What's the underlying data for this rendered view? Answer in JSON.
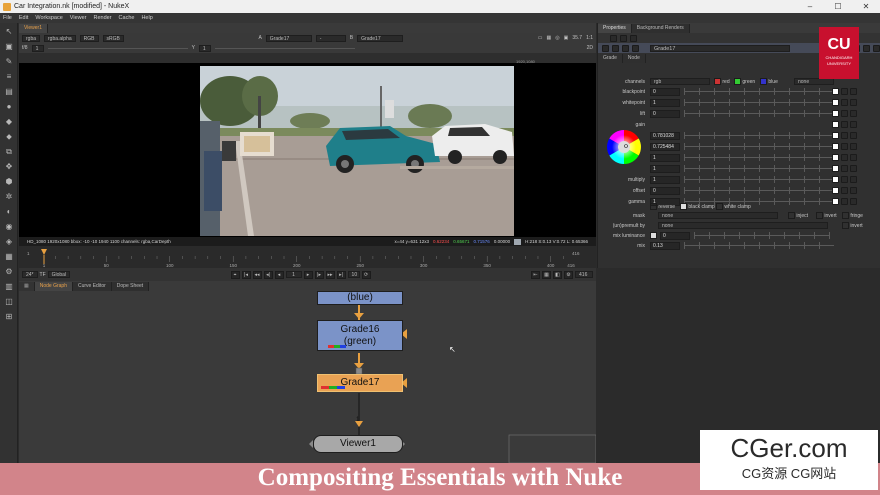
{
  "window": {
    "title": "Car Integration.nk [modified] - NukeX"
  },
  "menu": [
    "File",
    "Edit",
    "Workspace",
    "Viewer",
    "Render",
    "Cache",
    "Help"
  ],
  "viewer": {
    "tab": "Viewer1",
    "channel_set": "rgba",
    "channel": "rgba.alpha",
    "colorspace": "RGB",
    "lut": "sRGB",
    "frame_field": "1",
    "gain_field": "f/8",
    "exposure_field": "1",
    "input_a_label": "A",
    "input_a": "Grade17",
    "input_b_label": "B",
    "input_b": "Grade17",
    "compare_dash": "-",
    "zoom": "35.7",
    "proxy": "1:1",
    "view_mode": "2D",
    "corner_label": "1920,1080",
    "info_left": "HD_1080 1920x1080  bbox: -10 -10 1940 1100 channels: rgba,CarDepth",
    "info_mid": "x=44 y=631 12x3",
    "info_r": "0.62234",
    "info_g": "0.65671",
    "info_b": "0.71576",
    "info_a": "0.00000",
    "info_hsv": "H:218 S:0.13 V:0.72 L: 0.65366",
    "timeline_ticks": [
      "1",
      "50",
      "100",
      "150",
      "200",
      "250",
      "300",
      "350",
      "400",
      "416"
    ],
    "frame_start": "1",
    "frame_end": "416",
    "fps": "24*",
    "tf": "TF",
    "scope": "Global",
    "current_frame": "1",
    "step": "10",
    "end_frame_box": "416"
  },
  "node_panel": {
    "tabs": [
      "Node Graph",
      "Curve Editor",
      "Dope Sheet"
    ],
    "nodes": [
      {
        "name": "(blue)"
      },
      {
        "name": "Grade16",
        "sub": "(green)"
      },
      {
        "name": "Grade17"
      },
      {
        "name": "Viewer1"
      }
    ],
    "pipe_label": "1"
  },
  "properties": {
    "tabs": [
      "Properties",
      "Background Renders"
    ],
    "node_name": "Grade17",
    "subtabs": [
      "Grade",
      "Node"
    ],
    "channels_label": "channels",
    "channels_value": "rgb",
    "ch_red": "red",
    "ch_green": "green",
    "ch_blue": "blue",
    "ch_alpha": "none",
    "rows": [
      {
        "label": "blackpoint",
        "value": "0"
      },
      {
        "label": "whitepoint",
        "value": "1"
      },
      {
        "label": "lift",
        "value": "0"
      },
      {
        "label": "gain",
        "value": ""
      },
      {
        "label": "",
        "value": "0.781028"
      },
      {
        "label": "",
        "value": "0.725484"
      },
      {
        "label": "",
        "value": "1"
      },
      {
        "label": "",
        "value": "1"
      },
      {
        "label": "multiply",
        "value": "1"
      },
      {
        "label": "offset",
        "value": "0"
      },
      {
        "label": "gamma",
        "value": "1"
      }
    ],
    "reverse": "reverse",
    "black_clamp": "black clamp",
    "white_clamp": "white clamp",
    "mask_label": "mask",
    "mask_value": "none",
    "inject": "inject",
    "invert": "invert",
    "fringe": "fringe",
    "unpremult_label": "(un)premult by",
    "unpremult_value": "none",
    "invert2": "invert",
    "mix_lum_label": "mix luminance",
    "mix_lum_value": "0",
    "mix_label": "mix",
    "mix_value": "0.13"
  },
  "logo": {
    "initials": "CU",
    "line1": "CHANDIGARH",
    "line2": "UNIVERSITY"
  },
  "watermark": {
    "main": "CGer.com",
    "sub": "CG资源 CG网站"
  },
  "banner": {
    "text": "Compositing Essentials with Nuke"
  },
  "colors": {
    "node_blue": "#7b93c8",
    "node_selected": "#e9a254",
    "accent": "#e7a04a",
    "banner": "#d2848a",
    "logo_red": "#c8102e"
  }
}
